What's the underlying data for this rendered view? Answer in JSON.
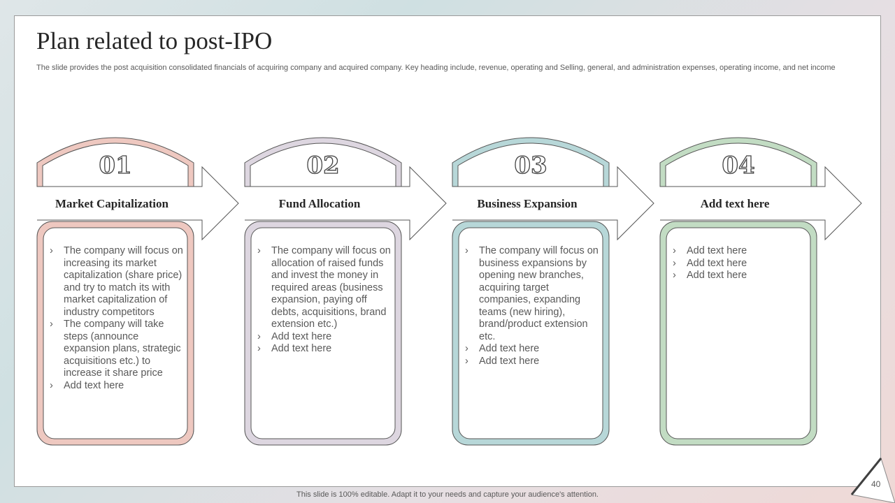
{
  "slide": {
    "title": "Plan related to post-IPO",
    "subtitle": "The slide provides the post acquisition consolidated financials of acquiring company and acquired company. Key heading include, revenue, operating and Selling, general, and administration expenses, operating income, and net income",
    "footer": "This slide is 100% editable. Adapt it to your needs and capture your audience's attention.",
    "page_number": "40"
  },
  "steps": [
    {
      "number": "01",
      "heading": "Market Capitalization",
      "color": "#eec8c0",
      "items": [
        "The company will focus on increasing its market capitalization (share price) and try to match its with market capitalization of industry competitors",
        "The company will take steps (announce expansion plans, strategic acquisitions etc.) to increase it share price",
        "Add text here"
      ]
    },
    {
      "number": "02",
      "heading": "Fund Allocation",
      "color": "#ddd6e0",
      "items": [
        "The company will focus on allocation of raised funds and invest the money in required areas (business expansion, paying off debts, acquisitions, brand extension etc.)",
        "Add text here",
        "Add text here"
      ]
    },
    {
      "number": "03",
      "heading": "Business Expansion",
      "color": "#b7d7d8",
      "items": [
        "The company will focus on business expansions by opening new branches, acquiring target companies, expanding teams (new hiring), brand/product extension etc.",
        "Add text here",
        "Add text here"
      ]
    },
    {
      "number": "04",
      "heading": "Add text here",
      "color": "#c2dcc3",
      "items": [
        "Add text here",
        "Add text here",
        "Add text here"
      ]
    }
  ]
}
